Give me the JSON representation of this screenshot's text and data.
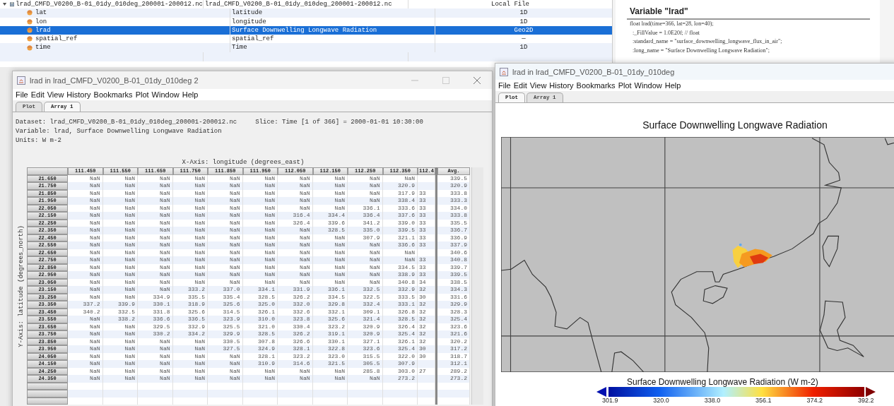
{
  "tree": {
    "root": {
      "name": "lrad_CMFD_V0200_B-01_01dy_010deg_200001-200012.nc",
      "description": "lrad_CMFD_V0200_B-01_01dy_010deg_200001-200012.nc",
      "type": "Local File",
      "expanded": true,
      "children": [
        {
          "name": "lat",
          "description": "latitude",
          "type": "1D",
          "selected": false
        },
        {
          "name": "lon",
          "description": "longitude",
          "type": "1D",
          "selected": false
        },
        {
          "name": "lrad",
          "description": "Surface Downwelling Longwave Radiation",
          "type": "Geo2D",
          "selected": true
        },
        {
          "name": "spatial_ref",
          "description": "spatial_ref",
          "type": "—",
          "selected": false
        },
        {
          "name": "time",
          "description": "Time",
          "type": "1D",
          "selected": false
        }
      ]
    }
  },
  "info_panel": {
    "heading": "Variable \"lrad\"",
    "lines": [
      "float lrad(time=366, lat=28, lon=40);",
      "  :_FillValue = 1.0E20f; // float",
      "  :standard_name = \"surface_downwelling_longwave_flux_in_air\";",
      "  :long_name = \"Surface Downwelling Longwave Radiation\";"
    ]
  },
  "array_window": {
    "title": "lrad in lrad_CMFD_V0200_B-01_01dy_010deg 2",
    "menu": [
      "File",
      "Edit",
      "View",
      "History",
      "Bookmarks",
      "Plot",
      "Window",
      "Help"
    ],
    "tabs": [
      {
        "label": "Plot",
        "selected": false
      },
      {
        "label": "Array 1",
        "selected": true
      }
    ],
    "dataset": "Dataset: lrad_CMFD_V0200_B-01_01dy_010deg_200001-200012.nc",
    "slice": "Slice: Time [1 of 366] = 2000-01-01 10:30:00",
    "variable": "Variable: lrad, Surface Downwelling Longwave Radiation",
    "units": "Units: W m-2",
    "x_axis_label": "X-Axis: longitude (degrees_east)",
    "y_axis_label": "Y-Axis: latitude (degrees_north)",
    "table": {
      "columns": [
        "111.450",
        "111.550",
        "111.650",
        "111.750",
        "111.850",
        "111.950",
        "112.050",
        "112.150",
        "112.250",
        "112.350"
      ],
      "cut_column": "112.4",
      "avg_column": "Avg.",
      "rows": [
        {
          "label": "21.650",
          "cells": [
            "NaN",
            "NaN",
            "NaN",
            "NaN",
            "NaN",
            "NaN",
            "NaN",
            "NaN",
            "NaN",
            "NaN"
          ],
          "avg": "339.5"
        },
        {
          "label": "21.750",
          "cells": [
            "NaN",
            "NaN",
            "NaN",
            "NaN",
            "NaN",
            "NaN",
            "NaN",
            "NaN",
            "NaN",
            "320.9"
          ],
          "avg": "320.9"
        },
        {
          "label": "21.850",
          "cells": [
            "NaN",
            "NaN",
            "NaN",
            "NaN",
            "NaN",
            "NaN",
            "NaN",
            "NaN",
            "NaN",
            "317.9"
          ],
          "cut": "33",
          "avg": "333.8"
        },
        {
          "label": "21.950",
          "cells": [
            "NaN",
            "NaN",
            "NaN",
            "NaN",
            "NaN",
            "NaN",
            "NaN",
            "NaN",
            "NaN",
            "338.4"
          ],
          "cut": "33",
          "avg": "333.3"
        },
        {
          "label": "22.050",
          "cells": [
            "NaN",
            "NaN",
            "NaN",
            "NaN",
            "NaN",
            "NaN",
            "NaN",
            "NaN",
            "336.1",
            "333.6"
          ],
          "cut": "33",
          "avg": "334.0"
        },
        {
          "label": "22.150",
          "cells": [
            "NaN",
            "NaN",
            "NaN",
            "NaN",
            "NaN",
            "NaN",
            "316.4",
            "334.4",
            "336.4",
            "337.6"
          ],
          "cut": "33",
          "avg": "333.8"
        },
        {
          "label": "22.250",
          "cells": [
            "NaN",
            "NaN",
            "NaN",
            "NaN",
            "NaN",
            "NaN",
            "326.4",
            "339.6",
            "341.2",
            "339.0"
          ],
          "cut": "33",
          "avg": "335.5"
        },
        {
          "label": "22.350",
          "cells": [
            "NaN",
            "NaN",
            "NaN",
            "NaN",
            "NaN",
            "NaN",
            "NaN",
            "328.5",
            "335.0",
            "339.5"
          ],
          "cut": "33",
          "avg": "336.7"
        },
        {
          "label": "22.450",
          "cells": [
            "NaN",
            "NaN",
            "NaN",
            "NaN",
            "NaN",
            "NaN",
            "NaN",
            "NaN",
            "307.9",
            "321.1"
          ],
          "cut": "33",
          "avg": "336.9"
        },
        {
          "label": "22.550",
          "cells": [
            "NaN",
            "NaN",
            "NaN",
            "NaN",
            "NaN",
            "NaN",
            "NaN",
            "NaN",
            "NaN",
            "336.6"
          ],
          "cut": "33",
          "avg": "337.9"
        },
        {
          "label": "22.650",
          "cells": [
            "NaN",
            "NaN",
            "NaN",
            "NaN",
            "NaN",
            "NaN",
            "NaN",
            "NaN",
            "NaN",
            "NaN"
          ],
          "avg": "340.6"
        },
        {
          "label": "22.750",
          "cells": [
            "NaN",
            "NaN",
            "NaN",
            "NaN",
            "NaN",
            "NaN",
            "NaN",
            "NaN",
            "NaN",
            "NaN"
          ],
          "cut": "33",
          "avg": "340.8"
        },
        {
          "label": "22.850",
          "cells": [
            "NaN",
            "NaN",
            "NaN",
            "NaN",
            "NaN",
            "NaN",
            "NaN",
            "NaN",
            "NaN",
            "334.5"
          ],
          "cut": "33",
          "avg": "339.7"
        },
        {
          "label": "22.950",
          "cells": [
            "NaN",
            "NaN",
            "NaN",
            "NaN",
            "NaN",
            "NaN",
            "NaN",
            "NaN",
            "NaN",
            "338.9"
          ],
          "cut": "33",
          "avg": "339.5"
        },
        {
          "label": "23.050",
          "cells": [
            "NaN",
            "NaN",
            "NaN",
            "NaN",
            "NaN",
            "NaN",
            "NaN",
            "NaN",
            "NaN",
            "340.8"
          ],
          "cut": "34",
          "avg": "338.5"
        },
        {
          "label": "23.150",
          "cells": [
            "NaN",
            "NaN",
            "NaN",
            "333.2",
            "337.0",
            "334.1",
            "331.9",
            "336.1",
            "332.5",
            "332.9"
          ],
          "cut": "32",
          "avg": "334.3"
        },
        {
          "label": "23.250",
          "cells": [
            "NaN",
            "NaN",
            "334.9",
            "335.5",
            "335.4",
            "328.5",
            "326.2",
            "334.5",
            "322.5",
            "333.5"
          ],
          "cut": "30",
          "avg": "331.6"
        },
        {
          "label": "23.350",
          "cells": [
            "337.2",
            "339.9",
            "330.1",
            "318.9",
            "325.6",
            "325.0",
            "332.0",
            "329.8",
            "332.4",
            "333.1"
          ],
          "cut": "32",
          "avg": "329.9"
        },
        {
          "label": "23.450",
          "cells": [
            "340.2",
            "332.5",
            "331.8",
            "325.6",
            "314.5",
            "326.1",
            "332.6",
            "332.1",
            "309.1",
            "326.8"
          ],
          "cut": "32",
          "avg": "328.3"
        },
        {
          "label": "23.550",
          "cells": [
            "NaN",
            "338.2",
            "336.6",
            "336.5",
            "323.9",
            "310.0",
            "323.8",
            "325.6",
            "321.4",
            "328.5"
          ],
          "cut": "32",
          "avg": "325.4"
        },
        {
          "label": "23.650",
          "cells": [
            "NaN",
            "NaN",
            "329.5",
            "332.9",
            "325.5",
            "321.0",
            "330.4",
            "323.2",
            "320.9",
            "326.4"
          ],
          "cut": "32",
          "avg": "323.6"
        },
        {
          "label": "23.750",
          "cells": [
            "NaN",
            "NaN",
            "330.2",
            "334.2",
            "329.9",
            "328.5",
            "326.2",
            "319.1",
            "320.9",
            "325.4"
          ],
          "cut": "32",
          "avg": "321.6"
        },
        {
          "label": "23.850",
          "cells": [
            "NaN",
            "NaN",
            "NaN",
            "NaN",
            "330.5",
            "307.8",
            "326.6",
            "330.1",
            "327.1",
            "326.1"
          ],
          "cut": "32",
          "avg": "320.2"
        },
        {
          "label": "23.950",
          "cells": [
            "NaN",
            "NaN",
            "NaN",
            "NaN",
            "327.5",
            "324.9",
            "328.1",
            "322.8",
            "323.6",
            "325.4"
          ],
          "cut": "30",
          "avg": "317.2"
        },
        {
          "label": "24.050",
          "cells": [
            "NaN",
            "NaN",
            "NaN",
            "NaN",
            "NaN",
            "328.1",
            "323.2",
            "323.0",
            "315.5",
            "322.0"
          ],
          "cut": "30",
          "avg": "318.7"
        },
        {
          "label": "24.150",
          "cells": [
            "NaN",
            "NaN",
            "NaN",
            "NaN",
            "NaN",
            "310.9",
            "314.6",
            "321.5",
            "305.5",
            "307.9"
          ],
          "avg": "312.1"
        },
        {
          "label": "24.250",
          "cells": [
            "NaN",
            "NaN",
            "NaN",
            "NaN",
            "NaN",
            "NaN",
            "NaN",
            "NaN",
            "285.8",
            "303.0"
          ],
          "cut": "27",
          "avg": "289.2"
        },
        {
          "label": "24.350",
          "cells": [
            "NaN",
            "NaN",
            "NaN",
            "NaN",
            "NaN",
            "NaN",
            "NaN",
            "NaN",
            "NaN",
            "273.2"
          ],
          "avg": "273.2"
        }
      ]
    }
  },
  "plot_window": {
    "title": "lrad in lrad_CMFD_V0200_B-01_01dy_010deg",
    "menu": [
      "File",
      "Edit",
      "View",
      "History",
      "Bookmarks",
      "Plot",
      "Window",
      "Help"
    ],
    "tabs": [
      {
        "label": "Plot",
        "selected": true
      },
      {
        "label": "Array 1",
        "selected": false
      }
    ],
    "plot_title": "Surface Downwelling Longwave Radiation",
    "colorbar": {
      "label": "Surface Downwelling Longwave Radiation (W m-2)",
      "ticks": [
        "301.9",
        "320.0",
        "338.0",
        "356.1",
        "374.2",
        "392.2"
      ]
    }
  }
}
